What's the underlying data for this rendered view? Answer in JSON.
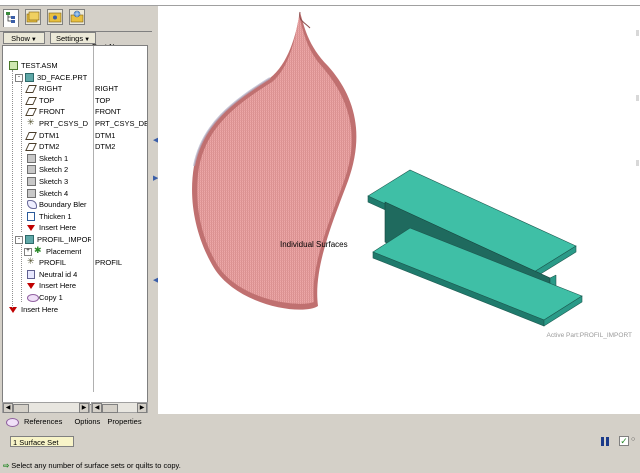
{
  "left_panel": {
    "show_label": "Show",
    "settings_label": "Settings",
    "column_header": "Feat Name"
  },
  "tree": [
    {
      "label": "TEST.ASM",
      "feat": "",
      "icon": "assembly-icon",
      "indent": 0
    },
    {
      "label": "3D_FACE.PRT",
      "feat": "",
      "icon": "part-icon",
      "indent": 1,
      "expander": "-"
    },
    {
      "label": "RIGHT",
      "feat": "RIGHT",
      "icon": "datum-plane-icon",
      "indent": 2
    },
    {
      "label": "TOP",
      "feat": "TOP",
      "icon": "datum-plane-icon",
      "indent": 2
    },
    {
      "label": "FRONT",
      "feat": "FRONT",
      "icon": "datum-plane-icon",
      "indent": 2
    },
    {
      "label": "PRT_CSYS_D",
      "feat": "PRT_CSYS_DEF",
      "icon": "csys-icon",
      "indent": 2
    },
    {
      "label": "DTM1",
      "feat": "DTM1",
      "icon": "datum-plane-icon",
      "indent": 2
    },
    {
      "label": "DTM2",
      "feat": "DTM2",
      "icon": "datum-plane-icon",
      "indent": 2
    },
    {
      "label": "Sketch 1",
      "feat": "",
      "icon": "sketch-icon",
      "indent": 2
    },
    {
      "label": "Sketch 2",
      "feat": "",
      "icon": "sketch-icon",
      "indent": 2
    },
    {
      "label": "Sketch 3",
      "feat": "",
      "icon": "sketch-icon",
      "indent": 2
    },
    {
      "label": "Sketch 4",
      "feat": "",
      "icon": "sketch-icon",
      "indent": 2
    },
    {
      "label": "Boundary Bler",
      "feat": "",
      "icon": "boundary-blend-icon",
      "indent": 2
    },
    {
      "label": "Thicken 1",
      "feat": "",
      "icon": "thicken-icon",
      "indent": 2
    },
    {
      "label": "Insert Here",
      "feat": "",
      "icon": "insert-here-icon",
      "indent": 2
    },
    {
      "label": "PROFIL_IMPORT",
      "feat": "",
      "icon": "part-icon",
      "indent": 1,
      "expander": "-"
    },
    {
      "label": "Placement",
      "feat": "",
      "icon": "placement-icon",
      "indent": 2,
      "expander": "+"
    },
    {
      "label": "PROFIL",
      "feat": "PROFIL",
      "icon": "csys-icon",
      "indent": 2
    },
    {
      "label": "Neutral id 4",
      "feat": "",
      "icon": "neutral-icon",
      "indent": 2
    },
    {
      "label": "Insert Here",
      "feat": "",
      "icon": "insert-here-icon",
      "indent": 2
    },
    {
      "label": "Copy 1",
      "feat": "",
      "icon": "copy-icon",
      "indent": 2
    },
    {
      "label": "Insert Here",
      "feat": "",
      "icon": "insert-here-icon",
      "indent": 0
    }
  ],
  "viewport": {
    "surface_label": "Individual Surfaces",
    "active_part": "Active Part:PROFIL_IMPORT"
  },
  "dashboard": {
    "tabs": [
      "References",
      "Options",
      "Properties"
    ],
    "collector_value": "1 Surface Set",
    "status_message": "Select any number of surface sets or quilts to copy."
  },
  "colors": {
    "surface": "#e8a0a0",
    "beam_top": "#3fbfa6",
    "beam_side": "#1f6a5e"
  }
}
